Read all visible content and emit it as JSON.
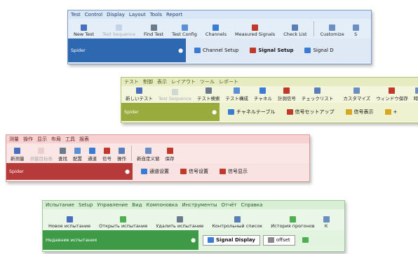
{
  "windows": [
    {
      "id": "english",
      "colors": {
        "menubar": "#d9e6f5",
        "toolbar": "#e4eef9",
        "dock": "#2e68b0",
        "tabs": "#dfe9f5",
        "menutext": "#1c3d6b",
        "border": "#7b9cc9"
      },
      "menu": [
        "Test",
        "Control",
        "Display",
        "Layout",
        "Tools",
        "Report"
      ],
      "toolbar": [
        {
          "label": "New Test",
          "icon": "new-test-icon",
          "color": "#4a6fbf",
          "disabled": false
        },
        {
          "label": "Test Sequence",
          "icon": "test-sequence-icon",
          "color": "#8aa0c8",
          "disabled": true
        },
        {
          "label": "Find Test",
          "icon": "find-test-icon",
          "color": "#6c7b8c",
          "disabled": false
        },
        {
          "label": "Test Config",
          "icon": "test-config-icon",
          "color": "#5b8fd6",
          "disabled": false
        },
        {
          "label": "Channels",
          "icon": "channels-icon",
          "color": "#3a7bd5",
          "disabled": false
        },
        {
          "label": "Measured Signals",
          "icon": "measured-signals-icon",
          "color": "#c0392b",
          "disabled": false
        },
        {
          "label": "Check List",
          "icon": "check-list-icon",
          "color": "#5a7fb8",
          "disabled": false
        },
        {
          "sep": true
        },
        {
          "label": "Customize",
          "icon": "customize-icon",
          "color": "#6b8fc2",
          "disabled": false
        },
        {
          "label": "S",
          "icon": "cut-off-icon",
          "color": "#6b8fc2",
          "disabled": false
        }
      ],
      "dock": "Spider",
      "tabs": [
        {
          "label": "Channel Setup",
          "icon": "channel-setup-icon",
          "color": "#3a7bd5",
          "active": false
        },
        {
          "label": "Signal Setup",
          "icon": "signal-setup-icon",
          "color": "#c0392b",
          "active": true
        },
        {
          "label": "Signal D",
          "icon": "signal-display-icon",
          "color": "#3a7bd5",
          "active": false
        }
      ]
    },
    {
      "id": "japanese",
      "colors": {
        "menubar": "#e7ecc0",
        "toolbar": "#f3f6dc",
        "dock": "#9aab3e",
        "tabs": "#eef2d0",
        "menutext": "#555e1f",
        "border": "#b6c172"
      },
      "menu": [
        "テスト",
        "制御",
        "表示",
        "レイアウト",
        "ツール",
        "レポート"
      ],
      "toolbar": [
        {
          "label": "新しいテスト",
          "icon": "new-test-icon",
          "color": "#4a6fbf",
          "disabled": false
        },
        {
          "label": "Test Sequence",
          "icon": "test-sequence-icon",
          "color": "#8aa0c8",
          "disabled": true
        },
        {
          "label": "テスト検索",
          "icon": "find-test-icon",
          "color": "#6c7b8c",
          "disabled": false
        },
        {
          "label": "テスト構成",
          "icon": "test-config-icon",
          "color": "#5b8fd6",
          "disabled": false
        },
        {
          "label": "チャネル",
          "icon": "channels-icon",
          "color": "#3a7bd5",
          "disabled": false
        },
        {
          "label": "計測信号",
          "icon": "measured-signals-icon",
          "color": "#c0392b",
          "disabled": false
        },
        {
          "label": "チェックリスト",
          "icon": "check-list-icon",
          "color": "#5a7fb8",
          "disabled": false
        },
        {
          "sep": true
        },
        {
          "label": "カスタマイズ",
          "icon": "customize-icon",
          "color": "#6b8fc2",
          "disabled": false
        },
        {
          "label": "ウィンドウ保存",
          "icon": "save-window-icon",
          "color": "#c0392b",
          "disabled": false
        },
        {
          "label": "時間",
          "icon": "time-icon",
          "color": "#6b8fc2",
          "disabled": false
        }
      ],
      "dock": "Spider",
      "tabs": [
        {
          "label": "チャネルテーブル",
          "icon": "channel-table-icon",
          "color": "#3a7bd5",
          "active": false
        },
        {
          "label": "信号セットアップ",
          "icon": "signal-setup-icon",
          "color": "#c0392b",
          "active": false
        },
        {
          "label": "信号表示",
          "icon": "signal-display-icon",
          "color": "#d9a620",
          "active": false
        },
        {
          "label": "+",
          "icon": "add-tab-icon",
          "color": "#d9a620",
          "active": false
        }
      ]
    },
    {
      "id": "chinese",
      "colors": {
        "menubar": "#f6d2d2",
        "toolbar": "#fbe6e6",
        "dock": "#b73a3a",
        "tabs": "#f8e2e2",
        "menutext": "#6b1f1f",
        "border": "#d99a9a"
      },
      "menu": [
        "测量",
        "操作",
        "显示",
        "布局",
        "工具",
        "报表"
      ],
      "toolbar": [
        {
          "label": "新测量",
          "icon": "new-test-icon",
          "color": "#4a6fbf",
          "disabled": false
        },
        {
          "label": "测量目标表",
          "icon": "test-sequence-icon",
          "color": "#c9a0a0",
          "disabled": true
        },
        {
          "label": "查找",
          "icon": "find-test-icon",
          "color": "#6c7b8c",
          "disabled": false
        },
        {
          "label": "配置",
          "icon": "test-config-icon",
          "color": "#5b8fd6",
          "disabled": false
        },
        {
          "label": "通道",
          "icon": "channels-icon",
          "color": "#3a7bd5",
          "disabled": false
        },
        {
          "label": "信号",
          "icon": "measured-signals-icon",
          "color": "#c0392b",
          "disabled": false
        },
        {
          "label": "操作",
          "icon": "operate-icon",
          "color": "#5a7fb8",
          "disabled": false
        },
        {
          "sep": true
        },
        {
          "label": "新自定义窗",
          "icon": "customize-icon",
          "color": "#6b8fc2",
          "disabled": false
        },
        {
          "label": "保存",
          "icon": "save-icon",
          "color": "#c0392b",
          "disabled": false
        }
      ],
      "dock": "Spider",
      "tabs": [
        {
          "label": "通道设置",
          "icon": "channel-setup-icon",
          "color": "#3a7bd5",
          "active": false
        },
        {
          "label": "信号设置",
          "icon": "signal-setup-icon",
          "color": "#c0392b",
          "active": false
        },
        {
          "label": "信号显示",
          "icon": "signal-display-icon",
          "color": "#c0392b",
          "active": false
        }
      ]
    },
    {
      "id": "russian",
      "colors": {
        "menubar": "#d8efd5",
        "toolbar": "#eaf7e8",
        "dock": "#3f9a48",
        "tabs": "#e2f3df",
        "menutext": "#245a2a",
        "border": "#9acb97"
      },
      "menu": [
        "Испытание",
        "Setup",
        "Управление",
        "Вид",
        "Компоновка",
        "Инструменты",
        "Отчёт",
        "Справка"
      ],
      "toolbar": [
        {
          "label": "Новое испытание",
          "icon": "new-test-icon",
          "color": "#4a6fbf",
          "disabled": false
        },
        {
          "label": "Открыть испытание",
          "icon": "open-test-icon",
          "color": "#4caf50",
          "disabled": false
        },
        {
          "label": "Удалить испытание",
          "icon": "delete-test-icon",
          "color": "#6c7b8c",
          "disabled": false
        },
        {
          "label": "Контрольный список",
          "icon": "check-list-icon",
          "color": "#5a7fb8",
          "disabled": false
        },
        {
          "label": "История прогонов",
          "icon": "run-history-icon",
          "color": "#4caf50",
          "disabled": false
        },
        {
          "label": "К",
          "icon": "cut-off-icon",
          "color": "#6b8fc2",
          "disabled": false
        }
      ],
      "dock": "Недавние испытания",
      "tabs": [
        {
          "label": "Signal Display",
          "icon": "signal-display-icon",
          "color": "#3a7bd5",
          "active": true,
          "boxed": true
        },
        {
          "label": "offset",
          "icon": "offset-icon",
          "color": "#888888",
          "active": false,
          "boxed": true
        },
        {
          "label": "",
          "icon": "dropdown-icon",
          "color": "#4caf50",
          "active": false
        }
      ]
    }
  ]
}
